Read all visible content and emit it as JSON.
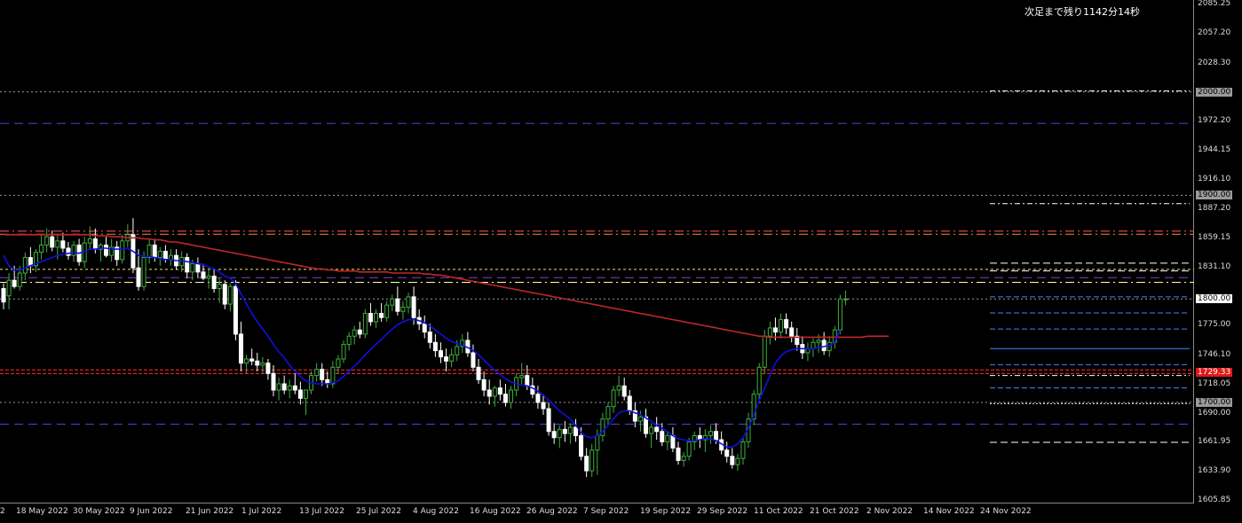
{
  "countdown_text": "次足まで残り1142分14秒",
  "colors": {
    "background": "#000000",
    "bull": "#3fae3f",
    "bear": "#ffffff",
    "ma_fast": "#1010e0",
    "ma_slow": "#c02828",
    "grid": "#9a9a9a",
    "axis_text": "#dddddd"
  },
  "price_axis": {
    "ticks": [
      "2085.25",
      "2057.20",
      "2028.30",
      "2000.00",
      "1972.20",
      "1944.15",
      "1916.10",
      "1900.00",
      "1887.20",
      "1859.15",
      "1831.10",
      "1800.00",
      "1775.00",
      "1746.10",
      "1729.33",
      "1718.05",
      "1700.00",
      "1690.00",
      "1661.95",
      "1633.90",
      "1605.85"
    ],
    "tags": [
      {
        "label": "2000.00",
        "bg": "#9a9a9a",
        "fg": "#000000"
      },
      {
        "label": "1900.00",
        "bg": "#9a9a9a",
        "fg": "#000000"
      },
      {
        "label": "1800.00",
        "bg": "#ffffff",
        "fg": "#000000"
      },
      {
        "label": "1729.33",
        "bg": "#e01818",
        "fg": "#ffffff"
      },
      {
        "label": "1700.00",
        "bg": "#9a9a9a",
        "fg": "#000000"
      }
    ]
  },
  "time_axis": {
    "labels": [
      "2",
      "18 May 2022",
      "30 May 2022",
      "9 Jun 2022",
      "21 Jun 2022",
      "1 Jul 2022",
      "13 Jul 2022",
      "25 Jul 2022",
      "4 Aug 2022",
      "16 Aug 2022",
      "26 Aug 2022",
      "7 Sep 2022",
      "19 Sep 2022",
      "29 Sep 2022",
      "11 Oct 2022",
      "21 Oct 2022",
      "2 Nov 2022",
      "14 Nov 2022",
      "24 Nov 2022"
    ]
  },
  "chart_data": {
    "type": "candlestick",
    "instrument_note": "",
    "ylim": [
      1605.85,
      2085.25
    ],
    "candle_count": 165,
    "candles": [
      [
        1810,
        1815,
        1790,
        1797
      ],
      [
        1803,
        1825,
        1790,
        1818
      ],
      [
        1818,
        1832,
        1810,
        1812
      ],
      [
        1812,
        1832,
        1808,
        1825
      ],
      [
        1825,
        1845,
        1818,
        1840
      ],
      [
        1840,
        1850,
        1825,
        1832
      ],
      [
        1832,
        1848,
        1826,
        1845
      ],
      [
        1845,
        1862,
        1838,
        1852
      ],
      [
        1852,
        1868,
        1845,
        1860
      ],
      [
        1860,
        1866,
        1846,
        1850
      ],
      [
        1850,
        1862,
        1838,
        1856
      ],
      [
        1856,
        1864,
        1845,
        1849
      ],
      [
        1849,
        1855,
        1838,
        1842
      ],
      [
        1842,
        1856,
        1836,
        1852
      ],
      [
        1852,
        1858,
        1832,
        1836
      ],
      [
        1836,
        1860,
        1830,
        1854
      ],
      [
        1854,
        1870,
        1848,
        1858
      ],
      [
        1858,
        1868,
        1844,
        1848
      ],
      [
        1848,
        1854,
        1836,
        1852
      ],
      [
        1852,
        1860,
        1840,
        1842
      ],
      [
        1842,
        1858,
        1836,
        1850
      ],
      [
        1850,
        1856,
        1832,
        1838
      ],
      [
        1838,
        1862,
        1834,
        1856
      ],
      [
        1856,
        1872,
        1850,
        1862
      ],
      [
        1862,
        1878,
        1825,
        1830
      ],
      [
        1830,
        1848,
        1808,
        1812
      ],
      [
        1812,
        1846,
        1808,
        1840
      ],
      [
        1840,
        1858,
        1834,
        1852
      ],
      [
        1852,
        1858,
        1836,
        1840
      ],
      [
        1840,
        1850,
        1832,
        1846
      ],
      [
        1846,
        1852,
        1835,
        1838
      ],
      [
        1838,
        1848,
        1832,
        1842
      ],
      [
        1842,
        1848,
        1828,
        1832
      ],
      [
        1832,
        1846,
        1826,
        1840
      ],
      [
        1840,
        1844,
        1820,
        1826
      ],
      [
        1826,
        1838,
        1818,
        1834
      ],
      [
        1834,
        1840,
        1820,
        1826
      ],
      [
        1826,
        1834,
        1818,
        1820
      ],
      [
        1820,
        1830,
        1810,
        1822
      ],
      [
        1822,
        1828,
        1806,
        1810
      ],
      [
        1810,
        1820,
        1796,
        1814
      ],
      [
        1814,
        1818,
        1790,
        1795
      ],
      [
        1795,
        1815,
        1788,
        1812
      ],
      [
        1812,
        1818,
        1760,
        1766
      ],
      [
        1766,
        1778,
        1730,
        1738
      ],
      [
        1738,
        1746,
        1728,
        1742
      ],
      [
        1742,
        1752,
        1736,
        1740
      ],
      [
        1740,
        1748,
        1730,
        1736
      ],
      [
        1736,
        1744,
        1728,
        1738
      ],
      [
        1738,
        1742,
        1722,
        1728
      ],
      [
        1728,
        1736,
        1706,
        1712
      ],
      [
        1712,
        1724,
        1702,
        1718
      ],
      [
        1718,
        1726,
        1708,
        1712
      ],
      [
        1712,
        1722,
        1704,
        1716
      ],
      [
        1716,
        1728,
        1708,
        1712
      ],
      [
        1712,
        1720,
        1698,
        1704
      ],
      [
        1704,
        1712,
        1688,
        1712
      ],
      [
        1712,
        1730,
        1708,
        1726
      ],
      [
        1726,
        1738,
        1720,
        1732
      ],
      [
        1732,
        1738,
        1716,
        1722
      ],
      [
        1722,
        1730,
        1714,
        1718
      ],
      [
        1718,
        1740,
        1714,
        1734
      ],
      [
        1734,
        1746,
        1728,
        1742
      ],
      [
        1742,
        1760,
        1738,
        1756
      ],
      [
        1756,
        1768,
        1750,
        1764
      ],
      [
        1764,
        1774,
        1756,
        1770
      ],
      [
        1770,
        1778,
        1762,
        1766
      ],
      [
        1766,
        1790,
        1762,
        1786
      ],
      [
        1786,
        1796,
        1774,
        1778
      ],
      [
        1778,
        1790,
        1772,
        1786
      ],
      [
        1786,
        1796,
        1778,
        1782
      ],
      [
        1782,
        1798,
        1778,
        1794
      ],
      [
        1794,
        1804,
        1788,
        1800
      ],
      [
        1800,
        1812,
        1784,
        1788
      ],
      [
        1788,
        1798,
        1780,
        1792
      ],
      [
        1792,
        1806,
        1786,
        1802
      ],
      [
        1802,
        1812,
        1775,
        1782
      ],
      [
        1782,
        1790,
        1770,
        1776
      ],
      [
        1776,
        1784,
        1762,
        1768
      ],
      [
        1768,
        1776,
        1752,
        1758
      ],
      [
        1758,
        1766,
        1744,
        1750
      ],
      [
        1750,
        1758,
        1738,
        1744
      ],
      [
        1744,
        1752,
        1730,
        1740
      ],
      [
        1740,
        1752,
        1734,
        1746
      ],
      [
        1746,
        1760,
        1740,
        1754
      ],
      [
        1754,
        1766,
        1748,
        1760
      ],
      [
        1760,
        1768,
        1744,
        1748
      ],
      [
        1748,
        1756,
        1730,
        1734
      ],
      [
        1734,
        1742,
        1718,
        1722
      ],
      [
        1722,
        1730,
        1706,
        1712
      ],
      [
        1712,
        1722,
        1698,
        1706
      ],
      [
        1706,
        1716,
        1696,
        1714
      ],
      [
        1714,
        1722,
        1702,
        1708
      ],
      [
        1708,
        1718,
        1696,
        1700
      ],
      [
        1700,
        1716,
        1694,
        1712
      ],
      [
        1712,
        1728,
        1706,
        1724
      ],
      [
        1724,
        1738,
        1718,
        1726
      ],
      [
        1726,
        1736,
        1712,
        1716
      ],
      [
        1716,
        1724,
        1704,
        1708
      ],
      [
        1708,
        1716,
        1694,
        1700
      ],
      [
        1700,
        1708,
        1688,
        1694
      ],
      [
        1694,
        1700,
        1668,
        1672
      ],
      [
        1672,
        1680,
        1660,
        1666
      ],
      [
        1666,
        1678,
        1656,
        1674
      ],
      [
        1674,
        1682,
        1662,
        1670
      ],
      [
        1670,
        1680,
        1660,
        1676
      ],
      [
        1676,
        1684,
        1662,
        1668
      ],
      [
        1668,
        1676,
        1644,
        1648
      ],
      [
        1648,
        1656,
        1628,
        1634
      ],
      [
        1634,
        1660,
        1628,
        1654
      ],
      [
        1654,
        1674,
        1630,
        1668
      ],
      [
        1668,
        1690,
        1662,
        1684
      ],
      [
        1684,
        1700,
        1678,
        1696
      ],
      [
        1696,
        1716,
        1690,
        1712
      ],
      [
        1712,
        1726,
        1706,
        1716
      ],
      [
        1716,
        1724,
        1702,
        1706
      ],
      [
        1706,
        1712,
        1688,
        1692
      ],
      [
        1692,
        1700,
        1676,
        1682
      ],
      [
        1682,
        1692,
        1672,
        1686
      ],
      [
        1686,
        1694,
        1666,
        1670
      ],
      [
        1670,
        1680,
        1656,
        1676
      ],
      [
        1676,
        1686,
        1664,
        1672
      ],
      [
        1672,
        1680,
        1658,
        1662
      ],
      [
        1662,
        1672,
        1654,
        1668
      ],
      [
        1668,
        1676,
        1652,
        1656
      ],
      [
        1656,
        1662,
        1640,
        1644
      ],
      [
        1644,
        1652,
        1638,
        1648
      ],
      [
        1648,
        1666,
        1644,
        1662
      ],
      [
        1662,
        1672,
        1654,
        1668
      ],
      [
        1668,
        1676,
        1656,
        1664
      ],
      [
        1664,
        1674,
        1652,
        1668
      ],
      [
        1668,
        1678,
        1660,
        1672
      ],
      [
        1672,
        1680,
        1660,
        1664
      ],
      [
        1664,
        1672,
        1650,
        1654
      ],
      [
        1654,
        1662,
        1642,
        1648
      ],
      [
        1648,
        1656,
        1636,
        1640
      ],
      [
        1640,
        1650,
        1634,
        1646
      ],
      [
        1646,
        1666,
        1640,
        1662
      ],
      [
        1662,
        1690,
        1656,
        1684
      ],
      [
        1684,
        1712,
        1678,
        1708
      ],
      [
        1708,
        1738,
        1702,
        1734
      ],
      [
        1734,
        1770,
        1728,
        1764
      ],
      [
        1764,
        1778,
        1756,
        1772
      ],
      [
        1772,
        1782,
        1760,
        1768
      ],
      [
        1768,
        1786,
        1762,
        1780
      ],
      [
        1780,
        1786,
        1766,
        1772
      ],
      [
        1772,
        1778,
        1758,
        1764
      ],
      [
        1764,
        1772,
        1750,
        1756
      ],
      [
        1756,
        1764,
        1742,
        1748
      ],
      [
        1748,
        1758,
        1740,
        1752
      ],
      [
        1752,
        1762,
        1744,
        1758
      ],
      [
        1758,
        1766,
        1748,
        1760
      ],
      [
        1760,
        1768,
        1746,
        1750
      ],
      [
        1750,
        1764,
        1744,
        1758
      ],
      [
        1758,
        1774,
        1752,
        1770
      ],
      [
        1770,
        1804,
        1766,
        1800
      ],
      [
        1800,
        1808,
        1794,
        1800
      ]
    ],
    "ma_fast_values": [
      1842,
      1832,
      1828,
      1828,
      1830,
      1832,
      1834,
      1836,
      1838,
      1840,
      1842,
      1843,
      1844,
      1845,
      1844,
      1846,
      1848,
      1848,
      1849,
      1849,
      1848,
      1848,
      1848,
      1849,
      1846,
      1842,
      1841,
      1841,
      1840,
      1839,
      1838,
      1838,
      1837,
      1837,
      1836,
      1835,
      1834,
      1833,
      1831,
      1829,
      1826,
      1822,
      1820,
      1815,
      1805,
      1795,
      1786,
      1778,
      1771,
      1764,
      1756,
      1749,
      1743,
      1736,
      1730,
      1725,
      1721,
      1719,
      1718,
      1718,
      1718,
      1719,
      1721,
      1725,
      1730,
      1735,
      1740,
      1746,
      1751,
      1756,
      1761,
      1766,
      1771,
      1775,
      1778,
      1780,
      1780,
      1779,
      1777,
      1774,
      1770,
      1766,
      1762,
      1759,
      1757,
      1755,
      1753,
      1750,
      1746,
      1741,
      1736,
      1731,
      1727,
      1723,
      1720,
      1718,
      1717,
      1716,
      1714,
      1711,
      1707,
      1702,
      1697,
      1692,
      1688,
      1684,
      1678,
      1671,
      1667,
      1666,
      1668,
      1672,
      1678,
      1684,
      1690,
      1692,
      1692,
      1690,
      1688,
      1685,
      1682,
      1678,
      1675,
      1672,
      1668,
      1665,
      1664,
      1663,
      1663,
      1664,
      1665,
      1665,
      1663,
      1660,
      1657,
      1657,
      1660,
      1666,
      1675,
      1688,
      1702,
      1714,
      1726,
      1738,
      1745,
      1749,
      1751,
      1752,
      1752,
      1752,
      1752,
      1753,
      1754,
      1755,
      1758,
      1770
    ],
    "ma_slow_values": [
      1862,
      1862,
      1862,
      1862,
      1862,
      1862,
      1862,
      1862,
      1862,
      1862,
      1862,
      1862,
      1862,
      1862,
      1862,
      1862,
      1862,
      1861,
      1861,
      1861,
      1860,
      1860,
      1860,
      1859,
      1859,
      1859,
      1858,
      1858,
      1857,
      1857,
      1856,
      1855,
      1855,
      1854,
      1853,
      1852,
      1851,
      1850,
      1849,
      1848,
      1847,
      1846,
      1845,
      1844,
      1843,
      1842,
      1841,
      1840,
      1839,
      1838,
      1837,
      1836,
      1835,
      1834,
      1833,
      1832,
      1831,
      1830,
      1829,
      1829,
      1828,
      1828,
      1827,
      1827,
      1827,
      1827,
      1826,
      1826,
      1826,
      1826,
      1826,
      1826,
      1825,
      1825,
      1825,
      1825,
      1825,
      1825,
      1824,
      1824,
      1823,
      1823,
      1822,
      1821,
      1820,
      1819,
      1818,
      1817,
      1816,
      1815,
      1814,
      1813,
      1812,
      1811,
      1810,
      1809,
      1808,
      1807,
      1806,
      1805,
      1804,
      1803,
      1802,
      1801,
      1800,
      1799,
      1798,
      1797,
      1796,
      1795,
      1794,
      1793,
      1792,
      1791,
      1790,
      1789,
      1788,
      1787,
      1786,
      1785,
      1784,
      1783,
      1782,
      1781,
      1780,
      1779,
      1778,
      1777,
      1776,
      1775,
      1774,
      1773,
      1772,
      1771,
      1770,
      1769,
      1768,
      1767,
      1766,
      1765,
      1764,
      1764,
      1763,
      1763,
      1763,
      1763,
      1763,
      1763,
      1763,
      1763,
      1763,
      1763,
      1763,
      1763,
      1763,
      1763,
      1763,
      1763,
      1763,
      1763,
      1764,
      1764,
      1764,
      1764,
      1764
    ],
    "horizontal_lines": [
      {
        "price": 2000.0,
        "color": "#9a9a9a",
        "dash": "2,3"
      },
      {
        "price": 1969.5,
        "color": "#5a3ecf",
        "dash": "10,6"
      },
      {
        "price": 1900.0,
        "color": "#9a9a9a",
        "dash": "2,3"
      },
      {
        "price": 1865.5,
        "color": "#ff5a5a",
        "dash": "10,4,2,4"
      },
      {
        "price": 1862.5,
        "color": "#ff8040",
        "dash": "10,4,2,4"
      },
      {
        "price": 1828.5,
        "color": "#ffe070",
        "dash": "3,3"
      },
      {
        "price": 1820.5,
        "color": "#8a3ecf",
        "dash": "10,6"
      },
      {
        "price": 1816.0,
        "color": "#ffffaa",
        "dash": "10,4,2,4"
      },
      {
        "price": 1800.0,
        "color": "#9a9a9a",
        "dash": "2,3"
      },
      {
        "price": 1731.5,
        "color": "#ff3030",
        "dash": "4,2"
      },
      {
        "price": 1728.0,
        "color": "#ff3030",
        "dash": "4,2"
      },
      {
        "price": 1700.0,
        "color": "#9a9a9a",
        "dash": "2,3"
      },
      {
        "price": 1679.0,
        "color": "#5a3ecf",
        "dash": "10,6"
      }
    ],
    "right_levels": [
      {
        "price": 2000.8,
        "color": "#ffffff",
        "dash": "6,3,2,3"
      },
      {
        "price": 1892.0,
        "color": "#ffffff",
        "dash": "6,3,2,3"
      },
      {
        "price": 1834.5,
        "color": "#ffffff",
        "dash": "8,4"
      },
      {
        "price": 1827.0,
        "color": "#ffffff",
        "dash": "8,4"
      },
      {
        "price": 1802.0,
        "color": "#3a8aff",
        "dash": "6,3"
      },
      {
        "price": 1786.5,
        "color": "#3a8aff",
        "dash": "6,3"
      },
      {
        "price": 1771.0,
        "color": "#3a8aff",
        "dash": "6,3"
      },
      {
        "price": 1752.0,
        "color": "#3a8aff",
        "dash": "none"
      },
      {
        "price": 1736.5,
        "color": "#3a8aff",
        "dash": "6,3"
      },
      {
        "price": 1726.0,
        "color": "#ffffff",
        "dash": "6,3,2,3"
      },
      {
        "price": 1714.0,
        "color": "#3a8aff",
        "dash": "6,3"
      },
      {
        "price": 1699.0,
        "color": "#ffffff",
        "dash": "2,2"
      },
      {
        "price": 1661.5,
        "color": "#ffffff",
        "dash": "8,4"
      }
    ]
  }
}
